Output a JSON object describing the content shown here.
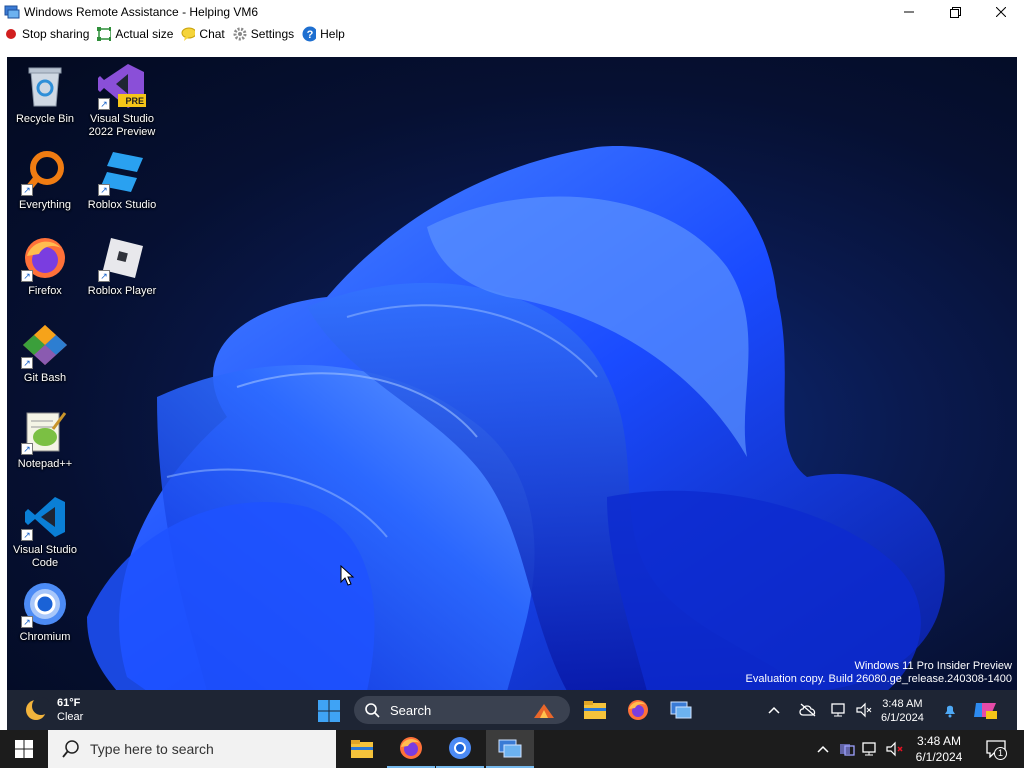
{
  "window": {
    "title": "Windows Remote Assistance - Helping VM6",
    "icon": "remote-assistance-icon"
  },
  "toolbar": {
    "stop_sharing": "Stop sharing",
    "actual_size": "Actual size",
    "chat": "Chat",
    "settings": "Settings",
    "help": "Help"
  },
  "desktop": {
    "icons": [
      {
        "label": "Recycle Bin",
        "icon": "recycle-bin-icon"
      },
      {
        "label": "Visual Studio 2022 Preview",
        "icon": "visual-studio-preview-icon",
        "badge": "PRE"
      },
      {
        "label": "Everything",
        "icon": "everything-icon"
      },
      {
        "label": "Roblox Studio",
        "icon": "roblox-studio-icon"
      },
      {
        "label": "Firefox",
        "icon": "firefox-icon"
      },
      {
        "label": "Roblox Player",
        "icon": "roblox-player-icon"
      },
      {
        "label": "Git Bash",
        "icon": "git-bash-icon"
      },
      {
        "label": "Notepad++",
        "icon": "notepad-plus-plus-icon"
      },
      {
        "label": "Visual Studio Code",
        "icon": "vscode-icon"
      },
      {
        "label": "Chromium",
        "icon": "chromium-icon"
      }
    ],
    "watermark_line1": "Windows 11 Pro Insider Preview",
    "watermark_line2": "Evaluation copy. Build 26080.ge_release.240308-1400"
  },
  "remote_taskbar": {
    "weather_temp": "61°F",
    "weather_desc": "Clear",
    "search_label": "Search",
    "pinned": [
      "file-explorer-icon",
      "firefox-icon",
      "remote-assistance-icon"
    ],
    "time": "3:48 AM",
    "date": "6/1/2024"
  },
  "taskbar": {
    "search_placeholder": "Type here to search",
    "apps": [
      "file-explorer-icon",
      "firefox-icon",
      "chromium-icon",
      "remote-assistance-icon"
    ],
    "time": "3:48 AM",
    "date": "6/1/2024",
    "notification_count": "1"
  },
  "colors": {
    "accent": "#76b9ed",
    "desktop_dark": "#061032",
    "bloom_blue": "#1a4bff",
    "taskbar": "#1c1c1c"
  }
}
